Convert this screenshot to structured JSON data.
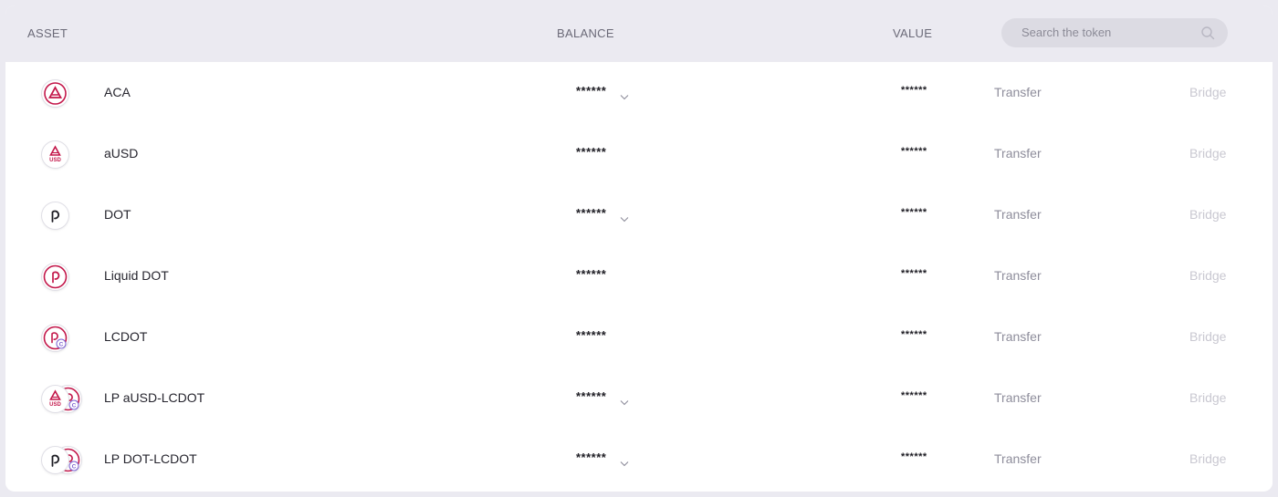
{
  "header": {
    "asset_label": "ASSET",
    "balance_label": "BALANCE",
    "value_label": "VALUE",
    "search_placeholder": "Search the token"
  },
  "rows": [
    {
      "name": "ACA",
      "balance": "******",
      "value": "******",
      "transfer": "Transfer",
      "bridge": "Bridge",
      "has_dropdown": true,
      "icon": "aca-icon"
    },
    {
      "name": "aUSD",
      "balance": "******",
      "value": "******",
      "transfer": "Transfer",
      "bridge": "Bridge",
      "has_dropdown": false,
      "icon": "ausd-icon"
    },
    {
      "name": "DOT",
      "balance": "******",
      "value": "******",
      "transfer": "Transfer",
      "bridge": "Bridge",
      "has_dropdown": true,
      "icon": "dot-icon"
    },
    {
      "name": "Liquid DOT",
      "balance": "******",
      "value": "******",
      "transfer": "Transfer",
      "bridge": "Bridge",
      "has_dropdown": false,
      "icon": "ldot-icon"
    },
    {
      "name": "LCDOT",
      "balance": "******",
      "value": "******",
      "transfer": "Transfer",
      "bridge": "Bridge",
      "has_dropdown": false,
      "icon": "lcdot-icon"
    },
    {
      "name": "LP aUSD-LCDOT",
      "balance": "******",
      "value": "******",
      "transfer": "Transfer",
      "bridge": "Bridge",
      "has_dropdown": true,
      "icon": "lp-ausd-lcdot-icon"
    },
    {
      "name": "LP DOT-LCDOT",
      "balance": "******",
      "value": "******",
      "transfer": "Transfer",
      "bridge": "Bridge",
      "has_dropdown": true,
      "icon": "lp-dot-lcdot-icon"
    }
  ],
  "colors": {
    "brand": "#c3174a",
    "header_bg": "#ebeaf1",
    "transfer_text": "#8e8d9b",
    "bridge_disabled": "#c9c8d1"
  }
}
